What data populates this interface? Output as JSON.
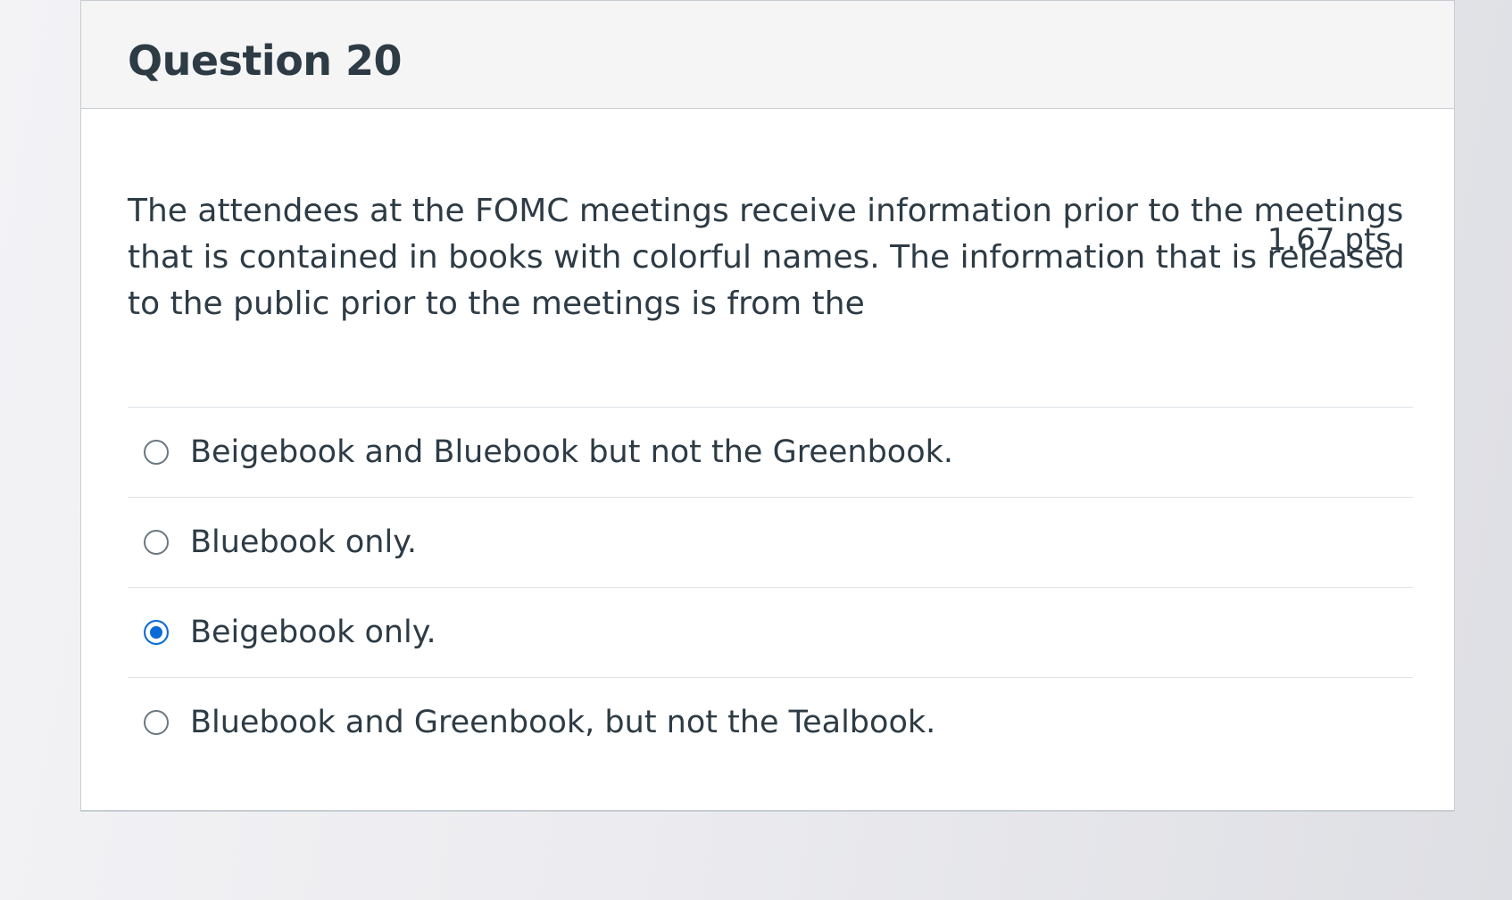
{
  "question": {
    "title": "Question 20",
    "points": "1.67 pts",
    "text": "The attendees at the FOMC meetings receive information prior to the meetings that is contained in books with colorful names. The information that is released to the public prior to the meetings is from the"
  },
  "answers": [
    {
      "label": "Beigebook and Bluebook but not the Greenbook.",
      "selected": false
    },
    {
      "label": "Bluebook only.",
      "selected": false
    },
    {
      "label": "Beigebook only.",
      "selected": true
    },
    {
      "label": "Bluebook and Greenbook, but not the Tealbook.",
      "selected": false
    }
  ],
  "colors": {
    "selected_radio": "#0b6bd6",
    "text": "#2d3b45"
  }
}
